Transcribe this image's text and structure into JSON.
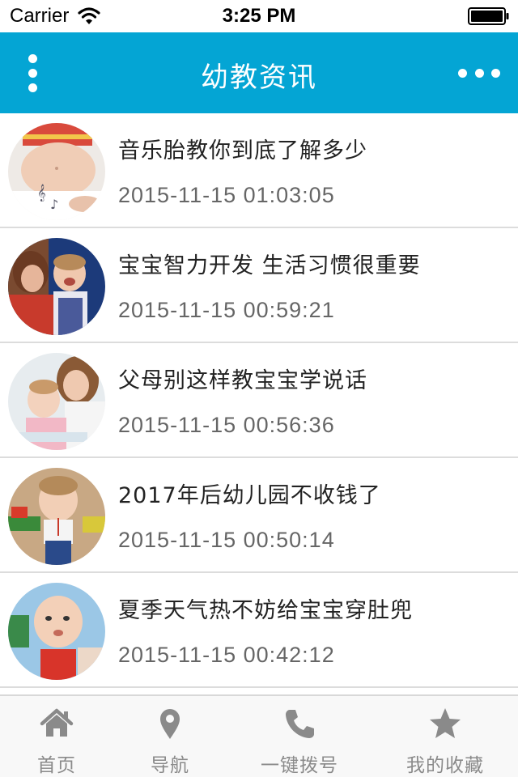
{
  "status_bar": {
    "carrier": "Carrier",
    "time": "3:25 PM"
  },
  "nav_bar": {
    "title": "幼教资讯",
    "background_color": "#04a5d4",
    "left_icon": "vertical-dots-icon",
    "right_icon": "more-horizontal-icon"
  },
  "news": [
    {
      "title": "音乐胎教你到底了解多少",
      "date": "2015-11-15 01:03:05",
      "thumb_icon": "pregnant-belly-photo"
    },
    {
      "title": "宝宝智力开发 生活习惯很重要",
      "date": "2015-11-15 00:59:21",
      "thumb_icon": "mother-baby-photo"
    },
    {
      "title": "父母别这样教宝宝学说话",
      "date": "2015-11-15 00:56:36",
      "thumb_icon": "mother-reading-baby-photo"
    },
    {
      "title": "2017年后幼儿园不收钱了",
      "date": "2015-11-15 00:50:14",
      "thumb_icon": "toddler-toys-photo"
    },
    {
      "title": "夏季天气热不妨给宝宝穿肚兜",
      "date": "2015-11-15 00:42:12",
      "thumb_icon": "baby-bib-photo"
    }
  ],
  "tab_bar": {
    "tabs": [
      {
        "label": "首页",
        "icon": "home-icon"
      },
      {
        "label": "导航",
        "icon": "map-pin-icon"
      },
      {
        "label": "一键拨号",
        "icon": "phone-icon"
      },
      {
        "label": "我的收藏",
        "icon": "star-icon"
      }
    ],
    "label_color": "#8a8a8a"
  }
}
